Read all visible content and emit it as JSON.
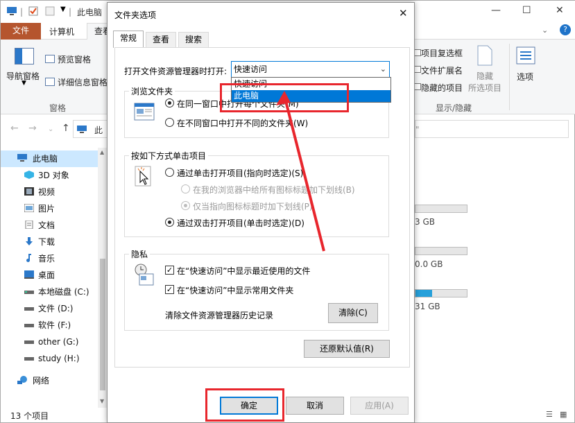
{
  "explorer": {
    "title": "此电脑",
    "tabs": {
      "file": "文件",
      "computer": "计算机",
      "view": "查看"
    },
    "ribbon": {
      "nav_pane": "导航窗格",
      "preview_pane": "预览窗格",
      "details_pane": "详细信息窗格",
      "panes_group": "窗格",
      "item_checkboxes": "项目复选框",
      "file_extensions": "文件扩展名",
      "hidden_items": "隐藏的项目",
      "hide": "隐藏",
      "hide_selected": "所选项目",
      "options": "选项",
      "show_hide_group": "显示/隐藏"
    },
    "address_fragment": "此",
    "sidebar": [
      {
        "label": "此电脑",
        "icon": "computer-icon",
        "selected": true
      },
      {
        "label": "3D 对象",
        "icon": "cube-3d-icon"
      },
      {
        "label": "视频",
        "icon": "video-icon"
      },
      {
        "label": "图片",
        "icon": "pictures-icon"
      },
      {
        "label": "文档",
        "icon": "document-icon"
      },
      {
        "label": "下载",
        "icon": "download-icon"
      },
      {
        "label": "音乐",
        "icon": "music-icon"
      },
      {
        "label": "桌面",
        "icon": "desktop-icon"
      },
      {
        "label": "本地磁盘 (C:)",
        "icon": "drive-icon"
      },
      {
        "label": "文件 (D:)",
        "icon": "drive-icon"
      },
      {
        "label": "软件 (F:)",
        "icon": "drive-icon"
      },
      {
        "label": "other (G:)",
        "icon": "drive-icon"
      },
      {
        "label": "study (H:)",
        "icon": "drive-icon"
      },
      {
        "label": "网络",
        "icon": "network-icon"
      }
    ],
    "drives_fragments": [
      {
        "text": "3 GB",
        "fill": 0.0
      },
      {
        "text": "0.0 GB",
        "fill": 0.0
      },
      {
        "text": "31 GB",
        "fill": 0.32
      }
    ],
    "status": "13 个项目"
  },
  "dialog": {
    "title": "文件夹选项",
    "tabs": [
      "常规",
      "查看",
      "搜索"
    ],
    "open_label": "打开文件资源管理器时打开:",
    "open_value": "快速访问",
    "open_options": [
      "快速访问",
      "此电脑"
    ],
    "browse_group": "浏览文件夹",
    "browse_same": "在同一窗口中打开每个文件夹(M)",
    "browse_new": "在不同窗口中打开不同的文件夹(W)",
    "click_group": "按如下方式单击项目",
    "single_click": "通过单击打开项目(指向时选定)(S)",
    "underline_all": "在我的浏览器中给所有图标标题加下划线(B)",
    "underline_point": "仅当指向图标标题时加下划线(P)",
    "double_click": "通过双击打开项目(单击时选定)(D)",
    "privacy_group": "隐私",
    "show_recent": "在“快速访问”中显示最近使用的文件",
    "show_frequent": "在“快速访问”中显示常用文件夹",
    "clear_history": "清除文件资源管理器历史记录",
    "clear_btn": "清除(C)",
    "restore_btn": "还原默认值(R)",
    "ok": "确定",
    "cancel": "取消",
    "apply": "应用(A)"
  },
  "colors": {
    "accent": "#0078d7",
    "file_tab": "#b5552e",
    "highlight": "#e8262d"
  }
}
